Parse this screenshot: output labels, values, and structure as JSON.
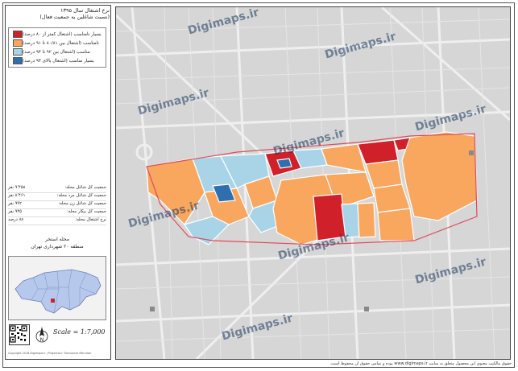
{
  "map": {
    "title_line1": "نرخ اشتغال سال ۱۳۹۵",
    "title_line2": "(نسبت شاغلین به جمعیت فعال)",
    "legend": [
      {
        "label": "بسیار نامناسب (اشتغال کمتر از ۸۰ درصد)",
        "color": "#d0202a"
      },
      {
        "label": "نامناسب (اشتغال بین ۸۰/۸۱ تا ۹۱ درصد)",
        "color": "#f9a75f"
      },
      {
        "label": "مناسب (اشتغال بین ۹۲ تا ۹۴ درصد)",
        "color": "#a9d4e8"
      },
      {
        "label": "بسیار مناسب (اشتغال بالای ۹۴ درصد)",
        "color": "#2f6fb0"
      }
    ],
    "stats": [
      {
        "label": "جمعیت کل شاغل محله:",
        "value": "۹٬۴۵۸ نفر"
      },
      {
        "label": "جمعیت کل شاغل مرد محله:",
        "value": "۸٬۴۶۱ نفر"
      },
      {
        "label": "جمعیت کل شاغل زن محله:",
        "value": "۹۹۲ نفر"
      },
      {
        "label": "جمعیت کل بیکار محله:",
        "value": "۹۴۵ نفر"
      },
      {
        "label": "نرخ اشتغال محله:",
        "value": "۸۸ درصد"
      }
    ],
    "location_line1": "محله استخر",
    "location_line2": "منطقه ۲۰ شهرداری تهران",
    "north_label": "N",
    "scale": "Scale = 1:7,000",
    "copyright_left": "Copyright 2018 Digimaps.ir | Projection: Transverse Mercator",
    "footer": "حقوق مالکیت معنوی این محصول متعلق به سایت www.digimaps.ir بوده و تمامی حقوق آن محفوظ است.",
    "watermark": "Digimaps.ir",
    "colors": {
      "very_poor": "#d0202a",
      "poor": "#f9a75f",
      "good": "#a9d4e8",
      "very_good": "#2f6fb0",
      "boundary": "#e04a5a",
      "background": "#d4d4d4"
    }
  }
}
